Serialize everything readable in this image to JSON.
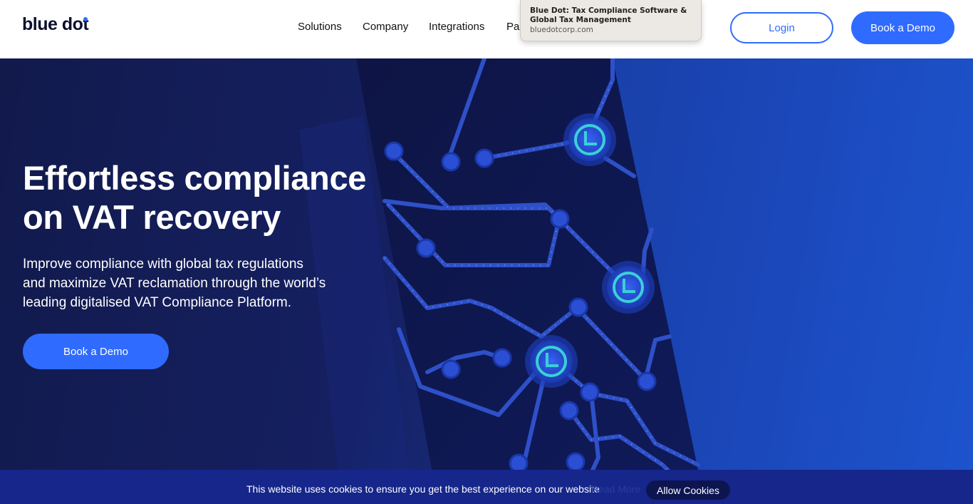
{
  "header": {
    "logo": "blue dot",
    "nav": [
      "Solutions",
      "Company",
      "Integrations",
      "Pa"
    ],
    "login_label": "Login",
    "demo_label": "Book a Demo"
  },
  "tooltip": {
    "title_line1": "Blue Dot: Tax Compliance Software &",
    "title_line2": "Global Tax Management",
    "url": "bluedotcorp.com"
  },
  "hero": {
    "title_line1": "Effortless compliance",
    "title_line2": "on VAT recovery",
    "subtitle_line1": "Improve compliance with global tax regulations",
    "subtitle_line2": "and maximize VAT reclamation through the world’s",
    "subtitle_line3": "leading digitalised VAT Compliance Platform.",
    "cta_label": "Book a Demo"
  },
  "cookie": {
    "text": "This website uses cookies to ensure you get the best experience on our website",
    "read_more": "Read More",
    "allow_label": "Allow Cookies"
  },
  "colors": {
    "accent": "#2f6bff",
    "hero_dark": "#121a4c",
    "hero_light": "#1f5ad4",
    "cookie_bar": "#16268a",
    "circuit_node": "#2b4fd4",
    "clock_teal": "#3ad0d6"
  },
  "icons": [
    "clock-icon"
  ]
}
